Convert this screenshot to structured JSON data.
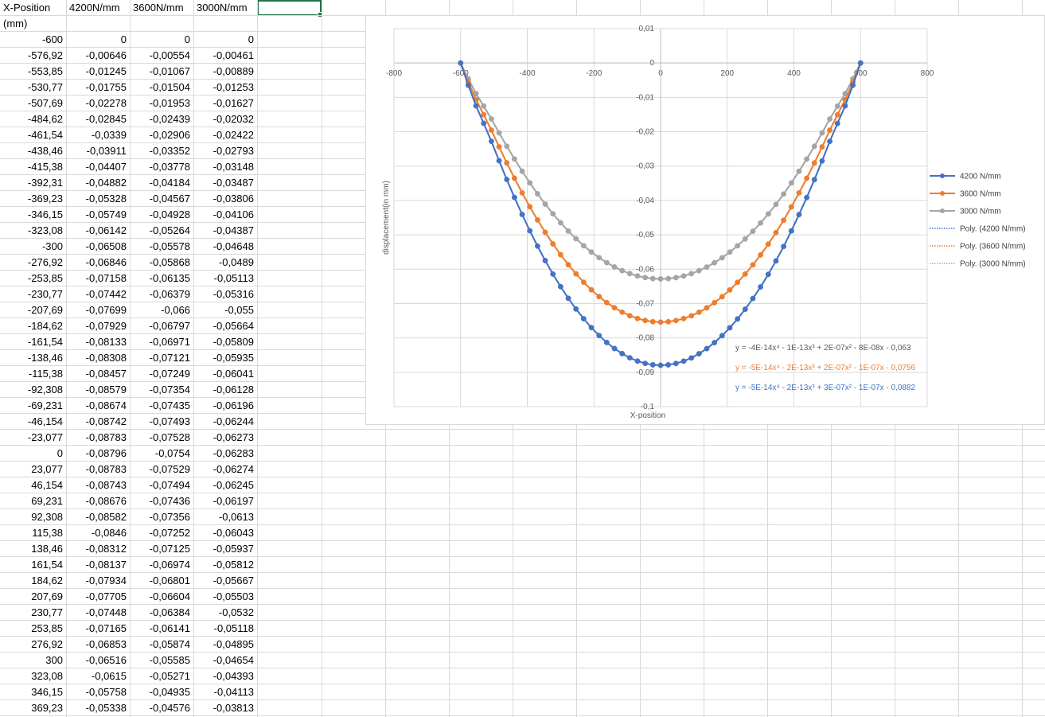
{
  "spreadsheet": {
    "headers": [
      "X-Position",
      "4200N/mm",
      "3600N/mm",
      "3000N/mm"
    ],
    "header_unit": "(mm)",
    "rows": [
      [
        "-600",
        "0",
        "0",
        "0"
      ],
      [
        "-576,92",
        "-0,00646",
        "-0,00554",
        "-0,00461"
      ],
      [
        "-553,85",
        "-0,01245",
        "-0,01067",
        "-0,00889"
      ],
      [
        "-530,77",
        "-0,01755",
        "-0,01504",
        "-0,01253"
      ],
      [
        "-507,69",
        "-0,02278",
        "-0,01953",
        "-0,01627"
      ],
      [
        "-484,62",
        "-0,02845",
        "-0,02439",
        "-0,02032"
      ],
      [
        "-461,54",
        "-0,0339",
        "-0,02906",
        "-0,02422"
      ],
      [
        "-438,46",
        "-0,03911",
        "-0,03352",
        "-0,02793"
      ],
      [
        "-415,38",
        "-0,04407",
        "-0,03778",
        "-0,03148"
      ],
      [
        "-392,31",
        "-0,04882",
        "-0,04184",
        "-0,03487"
      ],
      [
        "-369,23",
        "-0,05328",
        "-0,04567",
        "-0,03806"
      ],
      [
        "-346,15",
        "-0,05749",
        "-0,04928",
        "-0,04106"
      ],
      [
        "-323,08",
        "-0,06142",
        "-0,05264",
        "-0,04387"
      ],
      [
        "-300",
        "-0,06508",
        "-0,05578",
        "-0,04648"
      ],
      [
        "-276,92",
        "-0,06846",
        "-0,05868",
        "-0,0489"
      ],
      [
        "-253,85",
        "-0,07158",
        "-0,06135",
        "-0,05113"
      ],
      [
        "-230,77",
        "-0,07442",
        "-0,06379",
        "-0,05316"
      ],
      [
        "-207,69",
        "-0,07699",
        "-0,066",
        "-0,055"
      ],
      [
        "-184,62",
        "-0,07929",
        "-0,06797",
        "-0,05664"
      ],
      [
        "-161,54",
        "-0,08133",
        "-0,06971",
        "-0,05809"
      ],
      [
        "-138,46",
        "-0,08308",
        "-0,07121",
        "-0,05935"
      ],
      [
        "-115,38",
        "-0,08457",
        "-0,07249",
        "-0,06041"
      ],
      [
        "-92,308",
        "-0,08579",
        "-0,07354",
        "-0,06128"
      ],
      [
        "-69,231",
        "-0,08674",
        "-0,07435",
        "-0,06196"
      ],
      [
        "-46,154",
        "-0,08742",
        "-0,07493",
        "-0,06244"
      ],
      [
        "-23,077",
        "-0,08783",
        "-0,07528",
        "-0,06273"
      ],
      [
        "0",
        "-0,08796",
        "-0,0754",
        "-0,06283"
      ],
      [
        "23,077",
        "-0,08783",
        "-0,07529",
        "-0,06274"
      ],
      [
        "46,154",
        "-0,08743",
        "-0,07494",
        "-0,06245"
      ],
      [
        "69,231",
        "-0,08676",
        "-0,07436",
        "-0,06197"
      ],
      [
        "92,308",
        "-0,08582",
        "-0,07356",
        "-0,0613"
      ],
      [
        "115,38",
        "-0,0846",
        "-0,07252",
        "-0,06043"
      ],
      [
        "138,46",
        "-0,08312",
        "-0,07125",
        "-0,05937"
      ],
      [
        "161,54",
        "-0,08137",
        "-0,06974",
        "-0,05812"
      ],
      [
        "184,62",
        "-0,07934",
        "-0,06801",
        "-0,05667"
      ],
      [
        "207,69",
        "-0,07705",
        "-0,06604",
        "-0,05503"
      ],
      [
        "230,77",
        "-0,07448",
        "-0,06384",
        "-0,0532"
      ],
      [
        "253,85",
        "-0,07165",
        "-0,06141",
        "-0,05118"
      ],
      [
        "276,92",
        "-0,06853",
        "-0,05874",
        "-0,04895"
      ],
      [
        "300",
        "-0,06516",
        "-0,05585",
        "-0,04654"
      ],
      [
        "323,08",
        "-0,0615",
        "-0,05271",
        "-0,04393"
      ],
      [
        "346,15",
        "-0,05758",
        "-0,04935",
        "-0,04113"
      ],
      [
        "369,23",
        "-0,05338",
        "-0,04576",
        "-0,03813"
      ]
    ]
  },
  "chart_data": {
    "type": "scatter",
    "title": "",
    "xlabel": "X-position",
    "ylabel": "displacement(in mm)",
    "xlim": [
      -800,
      800
    ],
    "ylim": [
      -0.1,
      0.01
    ],
    "x_ticks": [
      "-800",
      "-600",
      "-400",
      "-200",
      "0",
      "200",
      "400",
      "600",
      "800"
    ],
    "y_ticks": [
      "0,01",
      "0",
      "-0,01",
      "-0,02",
      "-0,03",
      "-0,04",
      "-0,05",
      "-0,06",
      "-0,07",
      "-0,08",
      "-0,09",
      "-0,1"
    ],
    "grid": true,
    "legend_position": "right",
    "x": [
      -600,
      -576.92,
      -553.85,
      -530.77,
      -507.69,
      -484.62,
      -461.54,
      -438.46,
      -415.38,
      -392.31,
      -369.23,
      -346.15,
      -323.08,
      -300,
      -276.92,
      -253.85,
      -230.77,
      -207.69,
      -184.62,
      -161.54,
      -138.46,
      -115.38,
      -92.308,
      -69.231,
      -46.154,
      -23.077,
      0,
      23.077,
      46.154,
      69.231,
      92.308,
      115.38,
      138.46,
      161.54,
      184.62,
      207.69,
      230.77,
      253.85,
      276.92,
      300,
      323.08,
      346.15,
      369.23,
      392.31,
      415.38,
      438.46,
      461.54,
      484.62,
      507.69,
      530.77,
      553.85,
      576.92,
      600
    ],
    "series": [
      {
        "name": "4200 N/mm",
        "color": "#4472C4",
        "values": [
          0,
          -0.00646,
          -0.01245,
          -0.01755,
          -0.02278,
          -0.02845,
          -0.0339,
          -0.03911,
          -0.04407,
          -0.04882,
          -0.05328,
          -0.05749,
          -0.06142,
          -0.06508,
          -0.06846,
          -0.07158,
          -0.07442,
          -0.07699,
          -0.07929,
          -0.08133,
          -0.08308,
          -0.08457,
          -0.08579,
          -0.08674,
          -0.08742,
          -0.08783,
          -0.08796,
          -0.08783,
          -0.08743,
          -0.08676,
          -0.08582,
          -0.0846,
          -0.08312,
          -0.08137,
          -0.07934,
          -0.07705,
          -0.07448,
          -0.07165,
          -0.06853,
          -0.06516,
          -0.0615,
          -0.05758,
          -0.05338,
          -0.04885,
          -0.0441,
          -0.03915,
          -0.03393,
          -0.02848,
          -0.0228,
          -0.01757,
          -0.01246,
          -0.00647,
          0
        ]
      },
      {
        "name": "3600 N/mm",
        "color": "#ED7D31",
        "values": [
          0,
          -0.00554,
          -0.01067,
          -0.01504,
          -0.01953,
          -0.02439,
          -0.02906,
          -0.03352,
          -0.03778,
          -0.04184,
          -0.04567,
          -0.04928,
          -0.05264,
          -0.05578,
          -0.05868,
          -0.06135,
          -0.06379,
          -0.066,
          -0.06797,
          -0.06971,
          -0.07121,
          -0.07249,
          -0.07354,
          -0.07435,
          -0.07493,
          -0.07528,
          -0.0754,
          -0.07529,
          -0.07494,
          -0.07436,
          -0.07356,
          -0.07252,
          -0.07125,
          -0.06974,
          -0.06801,
          -0.06604,
          -0.06384,
          -0.06141,
          -0.05874,
          -0.05585,
          -0.05271,
          -0.04935,
          -0.04576,
          -0.04187,
          -0.0378,
          -0.03354,
          -0.02908,
          -0.02441,
          -0.01954,
          -0.01505,
          -0.01068,
          -0.00555,
          0
        ]
      },
      {
        "name": "3000 N/mm",
        "color": "#A5A5A5",
        "values": [
          0,
          -0.00461,
          -0.00889,
          -0.01253,
          -0.01627,
          -0.02032,
          -0.02422,
          -0.02793,
          -0.03148,
          -0.03487,
          -0.03806,
          -0.04106,
          -0.04387,
          -0.04648,
          -0.0489,
          -0.05113,
          -0.05316,
          -0.055,
          -0.05664,
          -0.05809,
          -0.05935,
          -0.06041,
          -0.06128,
          -0.06196,
          -0.06244,
          -0.06273,
          -0.06283,
          -0.06274,
          -0.06245,
          -0.06197,
          -0.0613,
          -0.06043,
          -0.05937,
          -0.05812,
          -0.05667,
          -0.05503,
          -0.0532,
          -0.05118,
          -0.04895,
          -0.04654,
          -0.04393,
          -0.04113,
          -0.03813,
          -0.03489,
          -0.0315,
          -0.02795,
          -0.02424,
          -0.02033,
          -0.01628,
          -0.01254,
          -0.0089,
          -0.00462,
          0
        ]
      }
    ],
    "trendlines": [
      {
        "name": "Poly. (4200 N/mm)",
        "color": "#4472C4"
      },
      {
        "name": "Poly. (3600 N/mm)",
        "color": "#ED7D31"
      },
      {
        "name": "Poly. (3000 N/mm)",
        "color": "#A5A5A5"
      }
    ],
    "equations": [
      {
        "text": "y = -4E-14x⁴ - 1E-13x³ + 2E-07x² - 8E-08x - 0,063",
        "color": "#595959"
      },
      {
        "text": "y = -5E-14x⁴ - 2E-13x³ + 2E-07x² - 1E-07x - 0,0756",
        "color": "#ED7D31"
      },
      {
        "text": "y = -5E-14x⁴ - 2E-13x³ + 3E-07x² - 1E-07x - 0,0882",
        "color": "#4472C4"
      }
    ]
  }
}
